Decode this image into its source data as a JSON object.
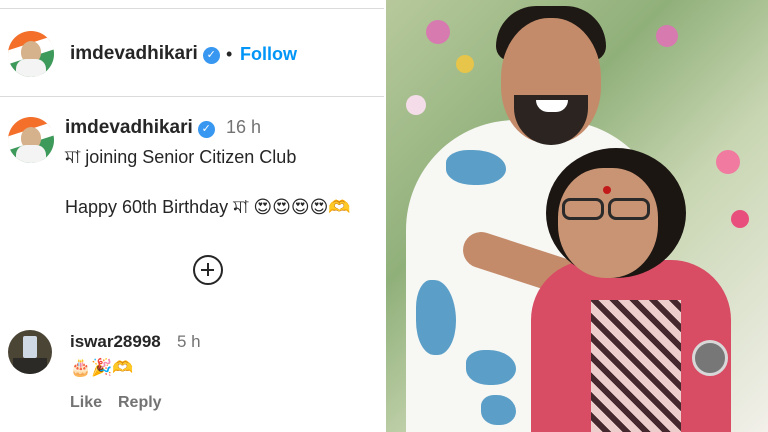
{
  "post": {
    "author": "imdevadhikari",
    "follow_label": "Follow",
    "separator": "•",
    "verified_badge": "✓",
    "caption": {
      "username": "imdevadhikari",
      "time": "16 h",
      "line1": "মা joining Senior Citizen Club",
      "line2": "Happy 60th Birthday মা 😍😍😍😍🫶"
    }
  },
  "reply": {
    "username": "iswar28998",
    "time": "5 h",
    "text": "🎂🎉🫶",
    "like_label": "Like",
    "reply_label": "Reply"
  },
  "icons": {
    "verified": "verified-badge-icon",
    "more_replies": "add-circle-icon"
  },
  "colors": {
    "link": "#0095f6",
    "verified": "#3897f0",
    "text": "#262626",
    "muted": "#737373"
  }
}
